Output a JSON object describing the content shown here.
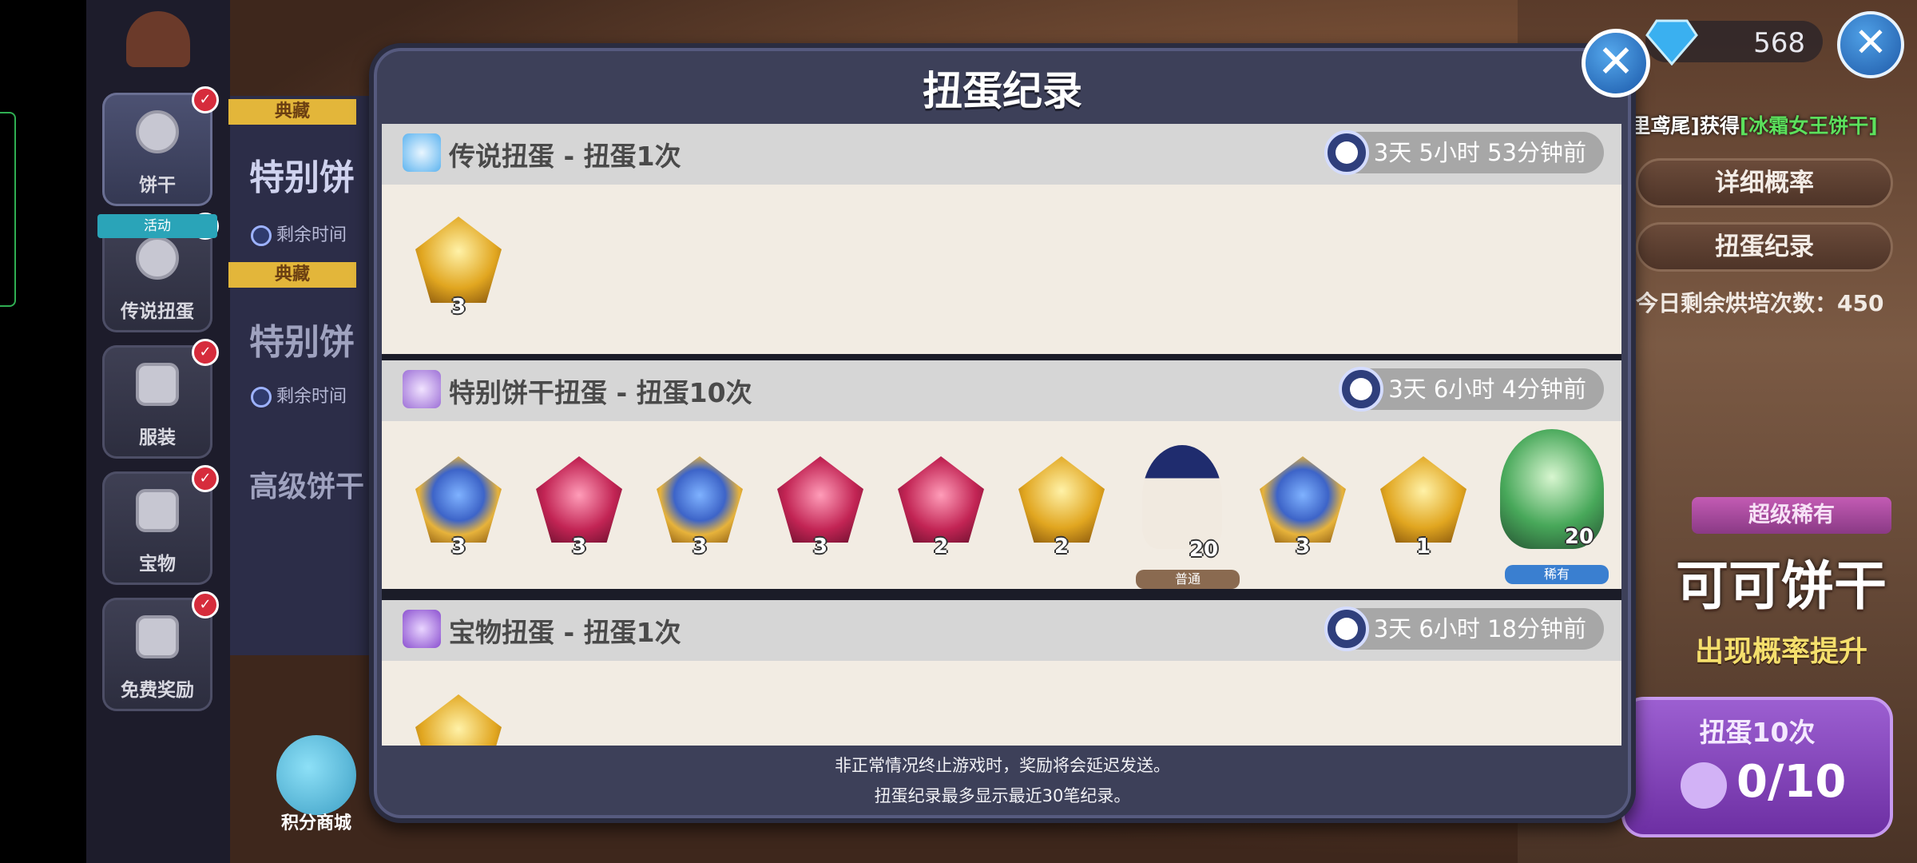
{
  "modal": {
    "title": "扭蛋纪录",
    "footer_line1": "非正常情况终止游戏时，奖励将会延迟发送。",
    "footer_line2": "扭蛋纪录最多显示最近30笔纪录。",
    "sections": [
      {
        "title": "传说扭蛋 - 扭蛋1次",
        "time": "3天 5小时 53分钟前",
        "icon": "snowflake-icon",
        "items": [
          {
            "count": "3",
            "style": "gold"
          }
        ]
      },
      {
        "title": "特别饼干扭蛋 - 扭蛋10次",
        "time": "3天 6小时 4分钟前",
        "icon": "cookie-swirl-icon",
        "items": [
          {
            "count": "3",
            "style": "gold-frame"
          },
          {
            "count": "3",
            "style": "pink"
          },
          {
            "count": "3",
            "style": "gold-frame"
          },
          {
            "count": "3",
            "style": "pink"
          },
          {
            "count": "2",
            "style": "pink"
          },
          {
            "count": "2",
            "style": "gold"
          },
          {
            "count": "20",
            "style": "cookie",
            "tag": "普通"
          },
          {
            "count": "3",
            "style": "gold-frame"
          },
          {
            "count": "1",
            "style": "gold"
          },
          {
            "count": "20",
            "style": "cookie",
            "tag": "稀有"
          }
        ]
      },
      {
        "title": "宝物扭蛋 - 扭蛋1次",
        "time": "3天 6小时 18分钟前",
        "icon": "treasure-book-icon",
        "items": [
          {
            "count": "",
            "style": "gold"
          }
        ]
      }
    ]
  },
  "sidebar": {
    "items": [
      {
        "label": "饼干",
        "icon": "cookie-icon"
      },
      {
        "label": "传说扭蛋",
        "icon": "legend-gacha-icon",
        "tag": "活动"
      },
      {
        "label": "服装",
        "icon": "costume-icon"
      },
      {
        "label": "宝物",
        "icon": "treasure-icon"
      },
      {
        "label": "免费奖励",
        "icon": "gift-icon"
      }
    ],
    "points_shop": "积分商城"
  },
  "banners": [
    {
      "tag": "典藏",
      "title": "特别饼",
      "sub": "剩余时间"
    },
    {
      "tag": "典藏",
      "title": "特别饼",
      "sub": "剩余时间"
    },
    {
      "title": "高级饼干"
    }
  ],
  "right_panel": {
    "detail_rate": "详细概率",
    "gacha_record": "扭蛋纪录",
    "bake_count": "今日剩余烘培次数：450",
    "super_rare": "超级稀有",
    "cookie_name": "可可饼干",
    "rate_up": "出现概率提升",
    "gacha10_label": "扭蛋10次",
    "gacha10_count": "0/10"
  },
  "header": {
    "gems": "568"
  },
  "ticker": {
    "prefix": "[乌苏里鸢尾]获得",
    "highlight": "[冰霜女王饼干]"
  },
  "colors": {
    "modal_bg": "#3d4059",
    "section_header": "#d6d6d6",
    "section_body": "#f2ece3",
    "accent_blue": "#1f5aa8",
    "gacha_purple": "#7b3bb3",
    "rate_up_yellow": "#f5df6c"
  }
}
